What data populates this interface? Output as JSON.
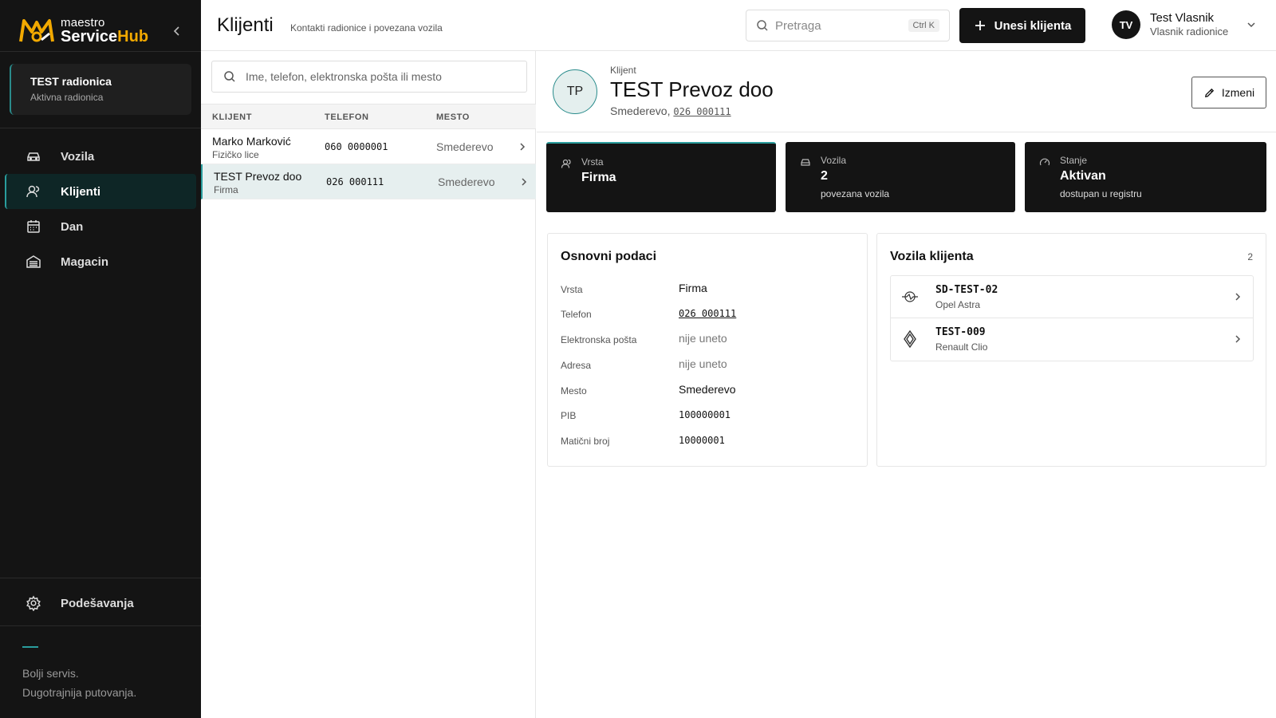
{
  "brand": {
    "top": "maestro",
    "service": "Service",
    "hub": "Hub"
  },
  "workshop": {
    "name": "TEST radionica",
    "status": "Aktivna radionica"
  },
  "nav": {
    "items": [
      {
        "label": "Vozila",
        "icon": "car-icon"
      },
      {
        "label": "Klijenti",
        "icon": "user-icon"
      },
      {
        "label": "Dan",
        "icon": "calendar-icon"
      },
      {
        "label": "Magacin",
        "icon": "warehouse-icon"
      }
    ],
    "settings_label": "Podešavanja"
  },
  "tagline": {
    "line1": "Bolji servis.",
    "line2": "Dugotrajnija putovanja."
  },
  "header": {
    "title": "Klijenti",
    "subtitle": "Kontakti radionice i povezana vozila",
    "search_placeholder": "Pretraga",
    "shortcut": "Ctrl K",
    "add_label": "Unesi klijenta"
  },
  "user": {
    "initials": "TV",
    "name": "Test Vlasnik",
    "role": "Vlasnik radionice"
  },
  "list": {
    "search_placeholder": "Ime, telefon, elektronska pošta ili mesto",
    "columns": [
      "KLIJENT",
      "TELEFON",
      "MESTO"
    ],
    "rows": [
      {
        "name": "Marko Marković",
        "type": "Fizičko lice",
        "phone": "060 0000001",
        "city": "Smederevo"
      },
      {
        "name": "TEST Prevoz doo",
        "type": "Firma",
        "phone": "026 000111",
        "city": "Smederevo"
      }
    ]
  },
  "client": {
    "initials": "TP",
    "label": "Klijent",
    "name": "TEST Prevoz doo",
    "city_prefix": "Smederevo,",
    "phone": "026 000111",
    "edit_label": "Izmeni"
  },
  "stats": [
    {
      "label": "Vrsta",
      "value": "Firma",
      "sub": ""
    },
    {
      "label": "Vozila",
      "value": "2",
      "sub": "povezana vozila"
    },
    {
      "label": "Stanje",
      "value": "Aktivan",
      "sub": "dostupan u registru"
    }
  ],
  "basic": {
    "title": "Osnovni podaci",
    "fields": [
      {
        "label": "Vrsta",
        "value": "Firma"
      },
      {
        "label": "Telefon",
        "value": "026 000111"
      },
      {
        "label": "Elektronska pošta",
        "value": "nije uneto"
      },
      {
        "label": "Adresa",
        "value": "nije uneto"
      },
      {
        "label": "Mesto",
        "value": "Smederevo"
      },
      {
        "label": "PIB",
        "value": "100000001"
      },
      {
        "label": "Matični broj",
        "value": "10000001"
      }
    ]
  },
  "vehicles": {
    "title": "Vozila klijenta",
    "count": "2",
    "items": [
      {
        "plate": "SD-TEST-02",
        "model": "Opel Astra",
        "icon": "opel-logo-icon"
      },
      {
        "plate": "TEST-009",
        "model": "Renault Clio",
        "icon": "renault-logo-icon"
      }
    ]
  },
  "colors": {
    "accent": "#2a9d9d",
    "sidebar": "#141414",
    "brand_orange": "#f2a900"
  }
}
